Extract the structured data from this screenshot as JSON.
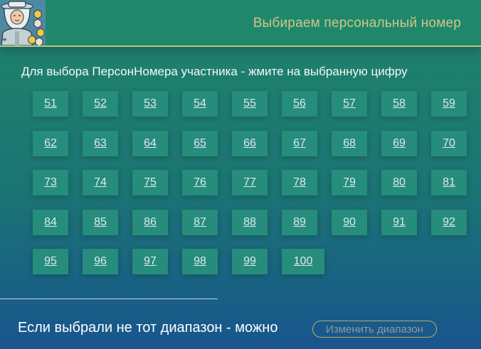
{
  "header": {
    "title": "Выбираем персональный номер",
    "logo_icon": "beekeeper-avatar-icon"
  },
  "instruction": "Для выбора ПерсонНомера участника - жмите на выбранную цифру",
  "numbers": [
    "51",
    "52",
    "53",
    "54",
    "55",
    "56",
    "57",
    "58",
    "59",
    "62",
    "63",
    "64",
    "65",
    "66",
    "67",
    "68",
    "69",
    "70",
    "73",
    "74",
    "75",
    "76",
    "77",
    "78",
    "79",
    "80",
    "81",
    "84",
    "85",
    "86",
    "87",
    "88",
    "89",
    "90",
    "91",
    "92",
    "95",
    "96",
    "97",
    "98",
    "99",
    "100"
  ],
  "footer": {
    "text": "Если выбрали не тот диапазон - можно",
    "change_button": "Изменить диапазон"
  },
  "colors": {
    "header_bg": "#20886a",
    "header_title": "#d1c58a",
    "button_bg": "#268c7b",
    "button_text": "#dce9f4",
    "change_border": "#b7ad6f"
  }
}
